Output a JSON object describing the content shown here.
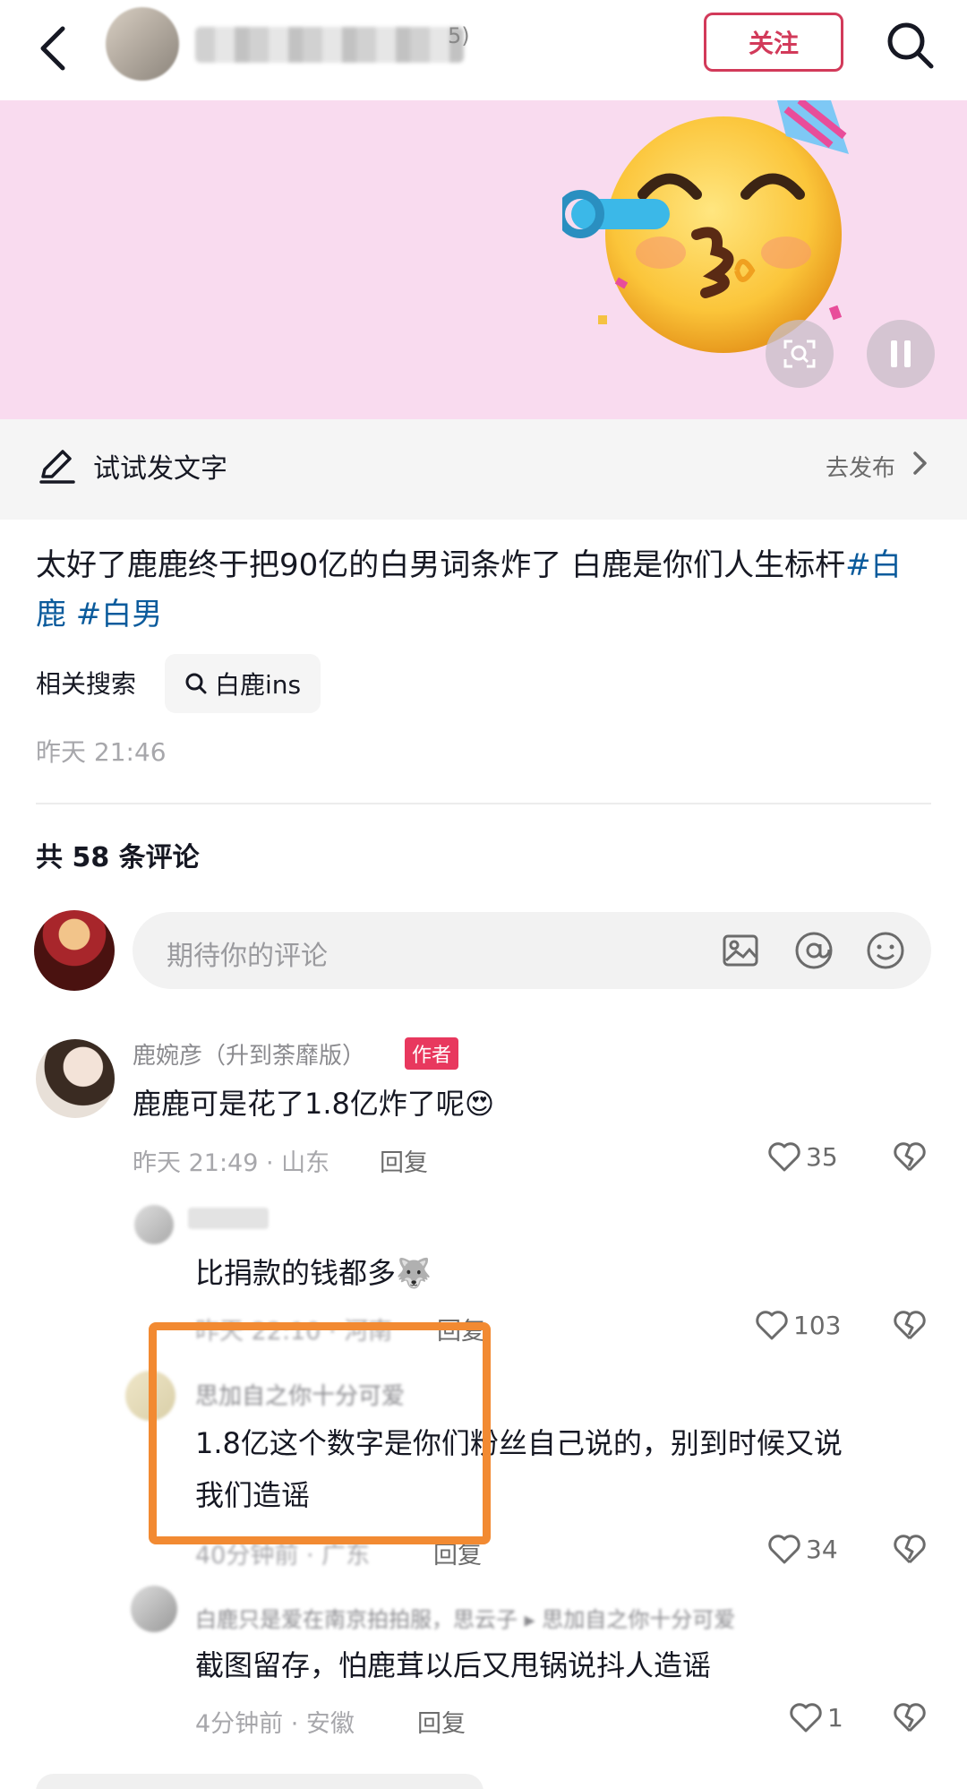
{
  "header": {
    "follow_label": "关注",
    "blurred_name_tail": "5)"
  },
  "trybar": {
    "label": "试试发文字",
    "action": "去发布"
  },
  "post": {
    "text_main": "太好了鹿鹿终于把90亿的白男词条炸了 白鹿是你们人生标杆",
    "hashtags": [
      "#白鹿",
      " #白男"
    ],
    "related_label": "相关搜索",
    "related_query": "白鹿ins",
    "time": "昨天 21:46"
  },
  "comments_header": {
    "count_text": "共 58 条评论"
  },
  "comment_input": {
    "placeholder": "期待你的评论"
  },
  "comments": [
    {
      "name": "鹿婉彦（升到荼靡版）",
      "tag": "作者",
      "text": "鹿鹿可是花了1.8亿炸了呢😍",
      "meta": "昨天 21:49 · 山东",
      "reply": "回复",
      "likes": "35"
    },
    {
      "name": "",
      "text": "比捐款的钱都多🐺",
      "meta": "昨天 22:10 · 河南",
      "reply": "回复",
      "likes": "103"
    },
    {
      "name": "思加自之你十分可爱",
      "text_line1": "1.8亿这个数字是你们粉丝自己说的，别到时候又说",
      "text_line2": "我们造谣",
      "meta": "40分钟前 · 广东",
      "reply": "回复",
      "likes": "34"
    },
    {
      "name": "白鹿只是爱在南京拍拍服，思云子 ▸ 思加自之你十分可爱",
      "text": "截图留存，怕鹿茸以后又甩锅说抖人造谣",
      "meta": "4分钟前 · 安徽",
      "reply": "回复",
      "likes": "1"
    }
  ],
  "colors": {
    "accent": "#e8385e",
    "follow": "#d23a5a",
    "hashtag": "#0b5b9c",
    "banner_bg": "#f9dbef",
    "highlight": "#f28a32"
  },
  "icons": [
    "back-icon",
    "search-icon",
    "pen-icon",
    "chevron-right-icon",
    "scan-icon",
    "pause-icon",
    "image-icon",
    "at-icon",
    "emoji-icon",
    "heart-icon",
    "broken-heart-icon"
  ]
}
